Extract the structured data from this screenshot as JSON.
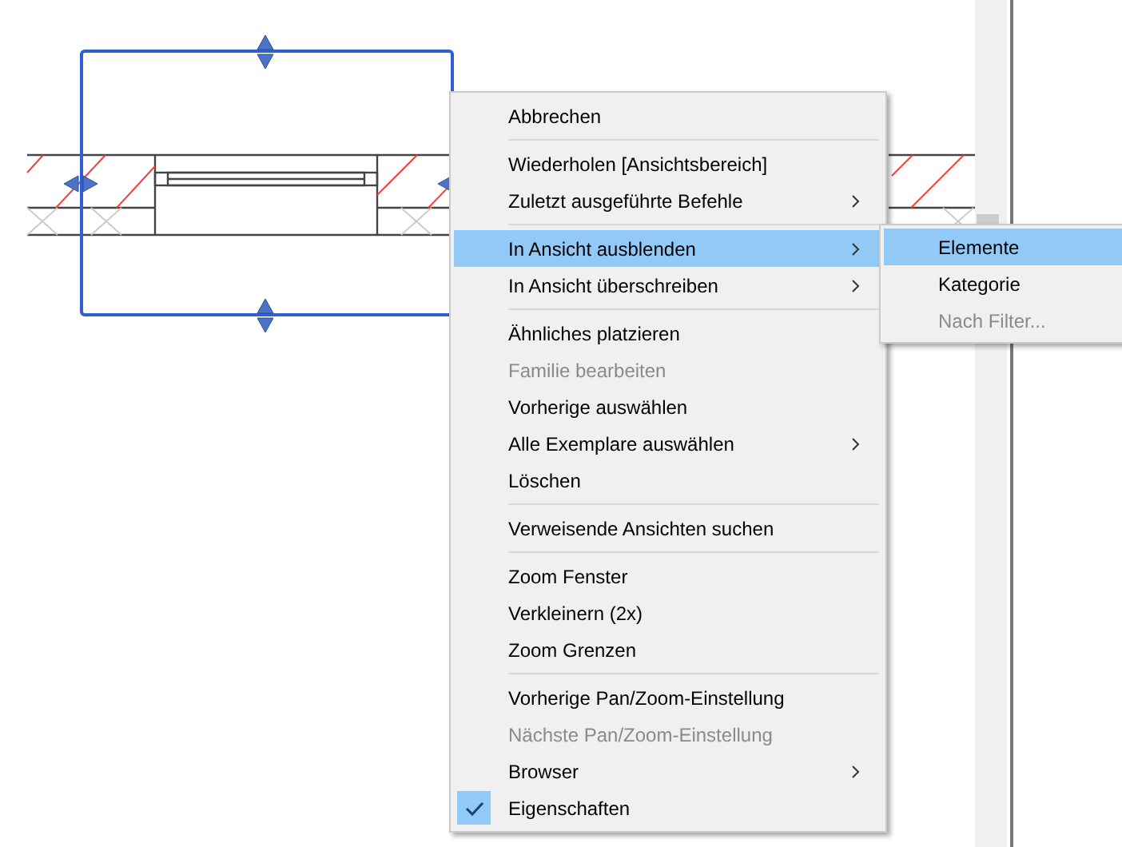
{
  "context_menu": {
    "items": [
      {
        "kind": "item",
        "label": "Abbrechen",
        "disabled": false,
        "selected": false,
        "submenu": false,
        "checked": false
      },
      {
        "kind": "separator"
      },
      {
        "kind": "item",
        "label": "Wiederholen [Ansichtsbereich]",
        "disabled": false,
        "selected": false,
        "submenu": false,
        "checked": false
      },
      {
        "kind": "item",
        "label": "Zuletzt ausgeführte Befehle",
        "disabled": false,
        "selected": false,
        "submenu": true,
        "checked": false
      },
      {
        "kind": "separator"
      },
      {
        "kind": "item",
        "label": "In Ansicht ausblenden",
        "disabled": false,
        "selected": true,
        "submenu": true,
        "checked": false
      },
      {
        "kind": "item",
        "label": "In Ansicht überschreiben",
        "disabled": false,
        "selected": false,
        "submenu": true,
        "checked": false
      },
      {
        "kind": "separator"
      },
      {
        "kind": "item",
        "label": "Ähnliches platzieren",
        "disabled": false,
        "selected": false,
        "submenu": false,
        "checked": false
      },
      {
        "kind": "item",
        "label": "Familie bearbeiten",
        "disabled": true,
        "selected": false,
        "submenu": false,
        "checked": false
      },
      {
        "kind": "item",
        "label": "Vorherige auswählen",
        "disabled": false,
        "selected": false,
        "submenu": false,
        "checked": false
      },
      {
        "kind": "item",
        "label": "Alle Exemplare auswählen",
        "disabled": false,
        "selected": false,
        "submenu": true,
        "checked": false
      },
      {
        "kind": "item",
        "label": "Löschen",
        "disabled": false,
        "selected": false,
        "submenu": false,
        "checked": false
      },
      {
        "kind": "separator"
      },
      {
        "kind": "item",
        "label": "Verweisende Ansichten suchen",
        "disabled": false,
        "selected": false,
        "submenu": false,
        "checked": false
      },
      {
        "kind": "separator"
      },
      {
        "kind": "item",
        "label": "Zoom Fenster",
        "disabled": false,
        "selected": false,
        "submenu": false,
        "checked": false
      },
      {
        "kind": "item",
        "label": "Verkleinern (2x)",
        "disabled": false,
        "selected": false,
        "submenu": false,
        "checked": false
      },
      {
        "kind": "item",
        "label": "Zoom Grenzen",
        "disabled": false,
        "selected": false,
        "submenu": false,
        "checked": false
      },
      {
        "kind": "separator"
      },
      {
        "kind": "item",
        "label": "Vorherige Pan/Zoom-Einstellung",
        "disabled": false,
        "selected": false,
        "submenu": false,
        "checked": false
      },
      {
        "kind": "item",
        "label": "Nächste Pan/Zoom-Einstellung",
        "disabled": true,
        "selected": false,
        "submenu": false,
        "checked": false
      },
      {
        "kind": "item",
        "label": "Browser",
        "disabled": false,
        "selected": false,
        "submenu": true,
        "checked": false
      },
      {
        "kind": "item",
        "label": "Eigenschaften",
        "disabled": false,
        "selected": false,
        "submenu": false,
        "checked": true
      }
    ]
  },
  "submenu": {
    "items": [
      {
        "label": "Elemente",
        "disabled": false,
        "selected": true
      },
      {
        "label": "Kategorie",
        "disabled": false,
        "selected": false
      },
      {
        "label": "Nach Filter...",
        "disabled": true,
        "selected": false
      }
    ]
  }
}
